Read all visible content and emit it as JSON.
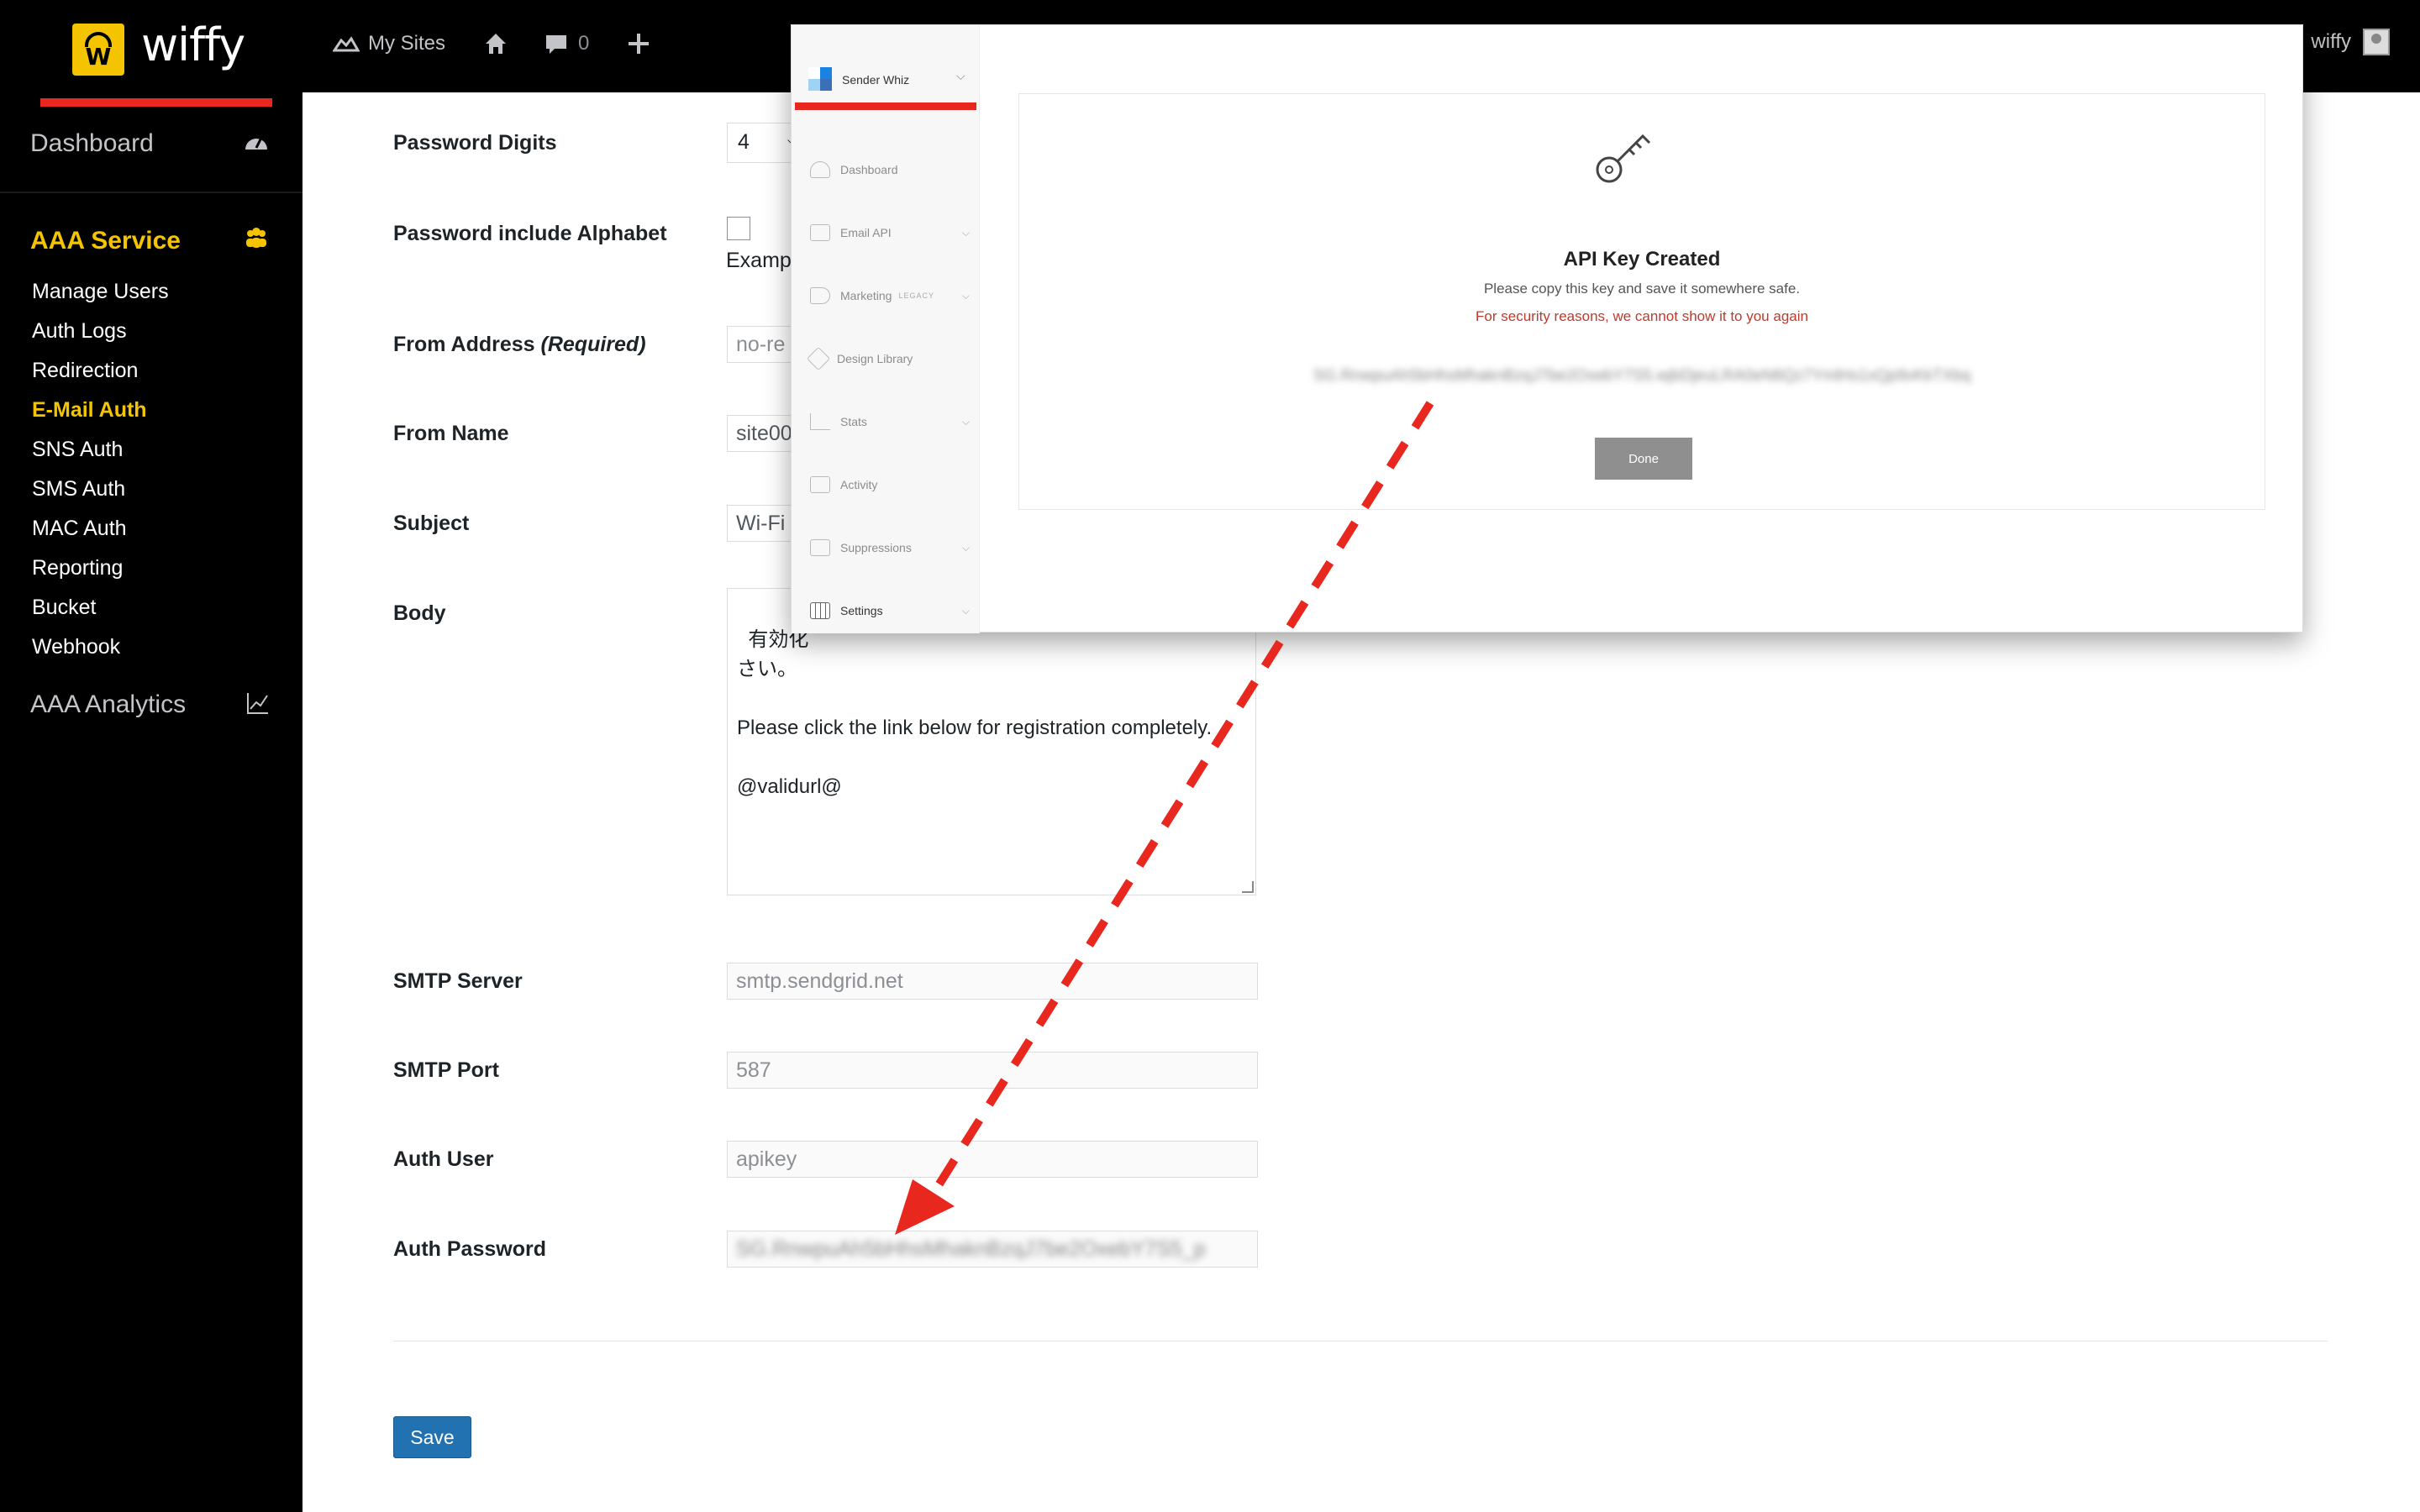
{
  "topbar": {
    "logo_mark": "W",
    "logo_text": "wiffy",
    "my_sites": "My Sites",
    "comments_count": "0",
    "user_name": "wiffy"
  },
  "sidebar": {
    "dashboard": "Dashboard",
    "section_title": "AAA Service",
    "items": [
      {
        "label": "Manage Users"
      },
      {
        "label": "Auth Logs"
      },
      {
        "label": "Redirection"
      },
      {
        "label": "E-Mail Auth"
      },
      {
        "label": "SNS Auth"
      },
      {
        "label": "SMS Auth"
      },
      {
        "label": "MAC Auth"
      },
      {
        "label": "Reporting"
      },
      {
        "label": "Bucket"
      },
      {
        "label": "Webhook"
      }
    ],
    "analytics": "AAA Analytics"
  },
  "form": {
    "password_digits_label": "Password Digits",
    "password_digits_value": "4",
    "password_alphabet_label": "Password include Alphabet",
    "example_text": "Examp",
    "from_address_label": "From Address",
    "required_text": "(Required)",
    "from_address_value": "no-re",
    "from_name_label": "From Name",
    "from_name_value": "site00",
    "subject_label": "Subject",
    "subject_value": "Wi-Fi",
    "body_label": "Body",
    "body_value": "有効化\nさい。\n\nPlease click the link below for registration completely.\n\n@validurl@",
    "smtp_server_label": "SMTP Server",
    "smtp_server_value": "smtp.sendgrid.net",
    "smtp_port_label": "SMTP Port",
    "smtp_port_value": "587",
    "auth_user_label": "Auth User",
    "auth_user_value": "apikey",
    "auth_password_label": "Auth Password",
    "auth_password_value": "SG.RnwpuAh5bHhsMhaknBzqJ7be2OxebY7S5_p",
    "save_label": "Save"
  },
  "overlay": {
    "brand": "Sender Whiz",
    "nav": [
      {
        "label": "Dashboard",
        "icon": "gauge-icon"
      },
      {
        "label": "Email API",
        "icon": "envelope-icon"
      },
      {
        "label": "Marketing",
        "icon": "megaphone-icon"
      },
      {
        "label": "Design Library",
        "icon": "brush-icon"
      },
      {
        "label": "Stats",
        "icon": "bar-chart-icon"
      },
      {
        "label": "Activity",
        "icon": "envelope-icon"
      },
      {
        "label": "Suppressions",
        "icon": "blocked-envelope-icon"
      },
      {
        "label": "Settings",
        "icon": "grid-icon"
      }
    ],
    "legacy_badge": "LEGACY",
    "card_title": "API Key Created",
    "card_message": "Please copy this key and save it somewhere safe.",
    "card_warning": "For security reasons, we cannot show it to you again",
    "api_key_value": "SG.RnwpuAh5bHhsMhaknBzqJ7be2OxebY7S5.wjbDjeuLRA0eN6Qz7YmlHs1xQp9vKkTXbq",
    "done_label": "Done"
  },
  "colors": {
    "accent_yellow": "#f5c400",
    "red": "#e8271e",
    "save_blue": "#2271b1",
    "warning_red": "#c0392b"
  }
}
